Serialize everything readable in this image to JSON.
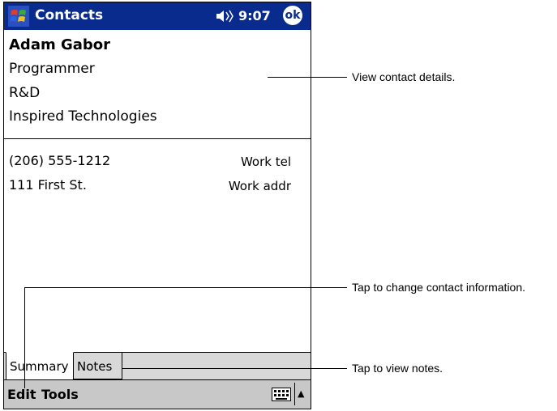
{
  "titlebar": {
    "app_title": "Contacts",
    "time": "9:07",
    "ok_label": "ok",
    "start_icon": "windows-flag-icon",
    "volume_icon": "speaker-icon"
  },
  "contact": {
    "name": "Adam Gabor",
    "title": "Programmer",
    "department": "R&D",
    "company": "Inspired Technologies"
  },
  "info_rows": [
    {
      "value": "(206) 555-1212",
      "label": "Work tel"
    },
    {
      "value": "111 First St.",
      "label": "Work addr"
    }
  ],
  "tabs": [
    "Summary",
    "Notes"
  ],
  "menu": {
    "edit": "Edit",
    "tools": "Tools",
    "keyboard_icon": "keyboard-icon",
    "sip_icon": "up-arrow-icon"
  },
  "callouts": {
    "view_details": "View contact details.",
    "change_info": "Tap to change contact information.",
    "view_notes": "Tap to view notes."
  },
  "colors": {
    "titlebar": "#0a2b8e",
    "menubar": "#c8c8c8",
    "tabstrip": "#d8d8d8"
  }
}
